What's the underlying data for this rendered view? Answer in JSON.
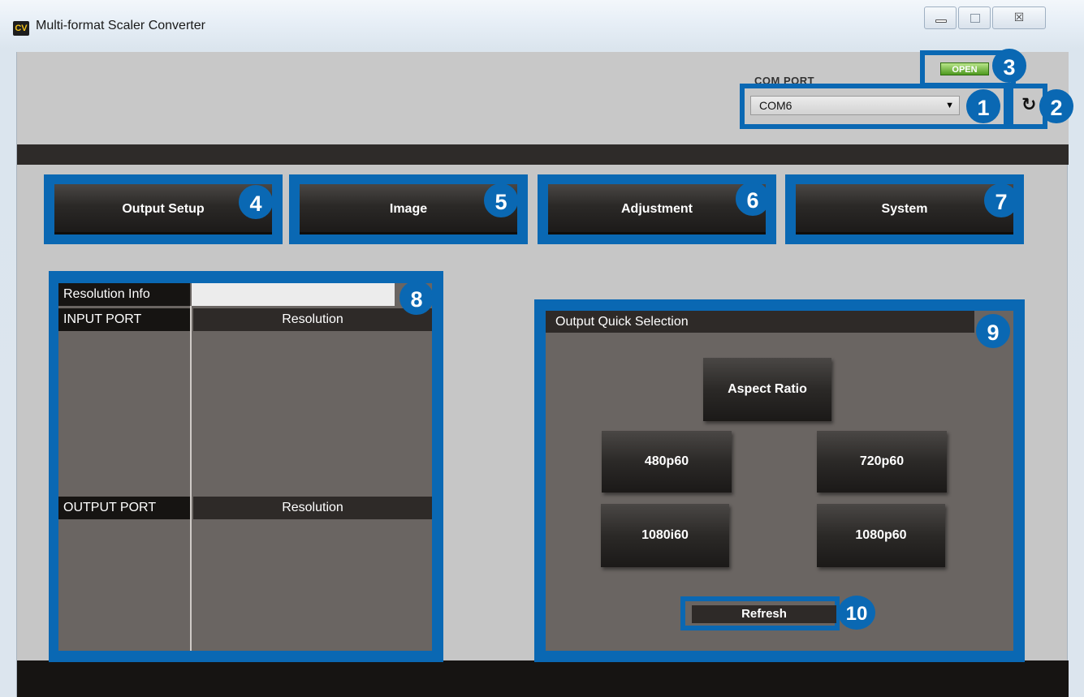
{
  "window": {
    "logo_text": "CV",
    "title": "Multi-format Scaler Converter",
    "controls": {
      "minimize_icon": "minimize-icon",
      "maximize_icon": "maximize-icon",
      "close_glyph": "☒"
    }
  },
  "com_port": {
    "label": "COM PORT",
    "selected": "COM6",
    "open_label": "OPEN",
    "refresh_icon": "↻"
  },
  "tabs": [
    {
      "label": "Output Setup",
      "badge": "4"
    },
    {
      "label": "Image",
      "badge": "5"
    },
    {
      "label": "Adjustment",
      "badge": "6"
    },
    {
      "label": "System",
      "badge": "7"
    }
  ],
  "badges": {
    "com_select": "1",
    "com_refresh": "2",
    "open": "3",
    "resolution_info": "8",
    "quick_selection": "9",
    "refresh": "10"
  },
  "resolution_info": {
    "title": "Resolution Info",
    "input_port": "INPUT PORT",
    "output_port": "OUTPUT PORT",
    "resolution": "Resolution"
  },
  "quick_selection": {
    "title": "Output Quick Selection",
    "aspect_ratio": "Aspect Ratio",
    "buttons": [
      "480p60",
      "720p60",
      "1080i60",
      "1080p60"
    ],
    "refresh": "Refresh"
  },
  "colors": {
    "annotation_blue": "#0a68b3",
    "panel_grey": "#6a6562",
    "button_dark": "#2b2927",
    "open_green": "#4e9a1f"
  }
}
